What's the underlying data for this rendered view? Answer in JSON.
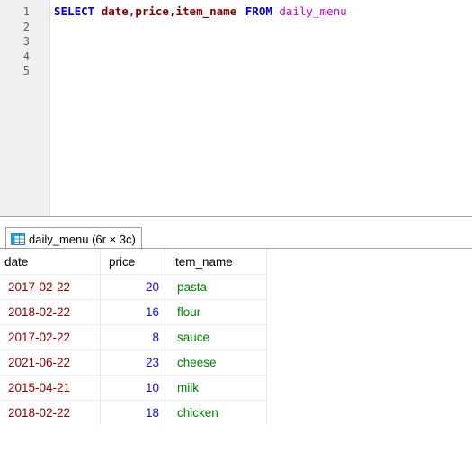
{
  "editor": {
    "line_numbers": [
      "1",
      "2",
      "3",
      "4",
      "5"
    ],
    "sql": {
      "select_kw": "SELECT",
      "col1": "date",
      "comma1": ",",
      "col2": "price",
      "comma2": ",",
      "col3": "item_name",
      "from_kw": "FROM",
      "table": "daily_menu"
    }
  },
  "result_tab": {
    "icon": "table-grid-icon",
    "label": "daily_menu (6r × 3c)"
  },
  "grid": {
    "columns": [
      "date",
      "price",
      "item_name"
    ],
    "rows": [
      {
        "date": "2017-02-22",
        "price": "20",
        "item_name": "pasta"
      },
      {
        "date": "2018-02-22",
        "price": "16",
        "item_name": "flour"
      },
      {
        "date": "2017-02-22",
        "price": "8",
        "item_name": "sauce"
      },
      {
        "date": "2021-06-22",
        "price": "23",
        "item_name": "cheese"
      },
      {
        "date": "2015-04-21",
        "price": "10",
        "item_name": "milk"
      },
      {
        "date": "2018-02-22",
        "price": "18",
        "item_name": "chicken"
      }
    ]
  },
  "colors": {
    "keyword": "#0000d0",
    "identifier": "#800000",
    "table_name": "#cc00cc",
    "date_value": "#8b0000",
    "number_value": "#1010d0",
    "text_value": "#008000"
  }
}
